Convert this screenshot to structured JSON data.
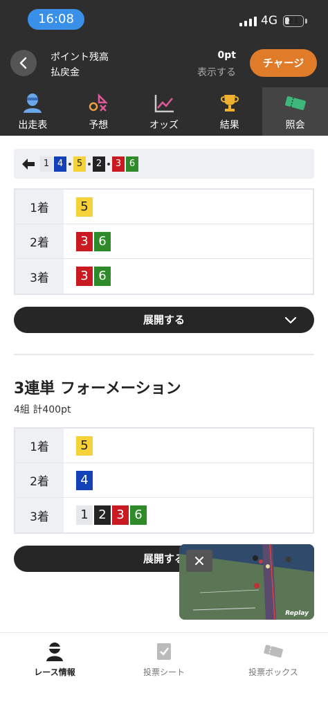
{
  "status_bar": {
    "time": "16:08",
    "network": "4G",
    "battery": "21"
  },
  "header": {
    "points_label": "ポイント残高",
    "refund_label": "払戻金",
    "points_value": "0pt",
    "show_link": "表示する",
    "charge_button": "チャージ"
  },
  "tabs": [
    {
      "label": "出走表"
    },
    {
      "label": "予想"
    },
    {
      "label": "オッズ"
    },
    {
      "label": "結果"
    },
    {
      "label": "照会"
    }
  ],
  "combo_bar": {
    "numbers": [
      "1",
      "4",
      "5",
      "2",
      "3",
      "6"
    ]
  },
  "first_table": {
    "rows": [
      {
        "label": "1着",
        "values": [
          "5"
        ]
      },
      {
        "label": "2着",
        "values": [
          "3",
          "6"
        ]
      },
      {
        "label": "3着",
        "values": [
          "3",
          "6"
        ]
      }
    ]
  },
  "expand_button": {
    "label": "展開する"
  },
  "section": {
    "title": "3連単 フォーメーション",
    "subtitle": "4組 計400pt"
  },
  "second_table": {
    "rows": [
      {
        "label": "1着",
        "values": [
          "5"
        ]
      },
      {
        "label": "2着",
        "values": [
          "4"
        ]
      },
      {
        "label": "3着",
        "values": [
          "1",
          "2",
          "3",
          "6"
        ]
      }
    ]
  },
  "expand_button_2": {
    "label": "展開する"
  },
  "video": {
    "overlay_text": "Replay"
  },
  "bottom_nav": [
    {
      "label": "レース情報"
    },
    {
      "label": "投票シート"
    },
    {
      "label": "投票ボックス"
    }
  ],
  "colors": {
    "header_bg": "#2e2e2e",
    "charge_orange": "#e07b2a",
    "time_blue": "#3a8fe8",
    "num_1": "#e6e7ea",
    "num_2": "#232323",
    "num_3": "#c81a20",
    "num_4": "#1342b8",
    "num_5": "#f4d238",
    "num_6": "#2f8a2a"
  }
}
